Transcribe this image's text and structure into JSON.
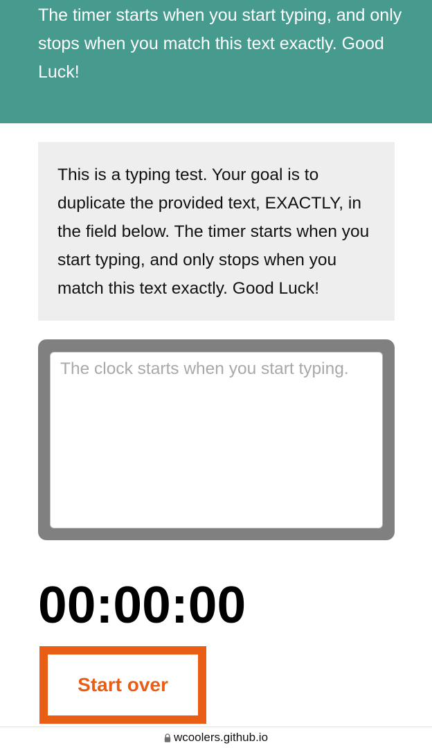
{
  "header": {
    "text": "The timer starts when you start typing, and only stops when you match this text exactly. Good Luck!"
  },
  "origin": {
    "text": "This is a typing test. Your goal is to duplicate the provided text, EXACTLY, in the field below. The timer starts when you start typing, and only stops when you match this text exactly. Good Luck!"
  },
  "test_area": {
    "value": "",
    "placeholder": "The clock starts when you start typing."
  },
  "timer": {
    "value": "00:00:00"
  },
  "reset_button": {
    "label": "Start over"
  },
  "browser": {
    "url": "wcoolers.github.io",
    "lock_icon": "lock-icon"
  }
}
